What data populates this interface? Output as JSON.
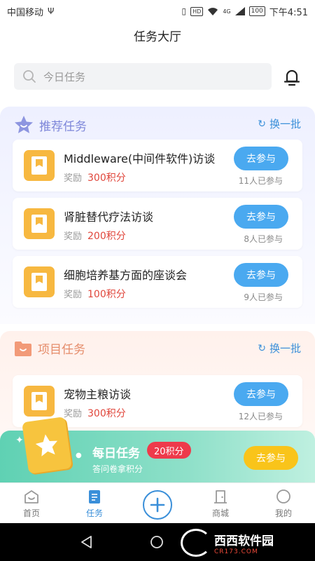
{
  "status_bar": {
    "carrier": "中国移动",
    "hd": "HD",
    "network": "4G",
    "battery": "100",
    "time": "下午4:51"
  },
  "header": {
    "title": "任务大厅"
  },
  "search": {
    "placeholder": "今日任务"
  },
  "recommended": {
    "title": "推荐任务",
    "refresh_label": "换一批",
    "tasks": [
      {
        "title": "Middleware(中间件软件)访谈",
        "reward_label": "奖励",
        "points": "300积分",
        "button": "去参与",
        "participants": "11人已参与"
      },
      {
        "title": "肾脏替代疗法访谈",
        "reward_label": "奖励",
        "points": "200积分",
        "button": "去参与",
        "participants": "8人已参与"
      },
      {
        "title": "细胞培养基方面的座谈会",
        "reward_label": "奖励",
        "points": "100积分",
        "button": "去参与",
        "participants": "9人已参与"
      }
    ]
  },
  "project": {
    "title": "项目任务",
    "refresh_label": "换一批",
    "tasks": [
      {
        "title": "宠物主粮访谈",
        "reward_label": "奖励",
        "points": "300积分",
        "button": "去参与",
        "participants": "12人已参与"
      }
    ]
  },
  "daily_banner": {
    "title": "每日任务",
    "badge": "20积分",
    "subtitle": "答问卷拿积分",
    "button": "去参与"
  },
  "tab_bar": {
    "items": [
      {
        "label": "首页",
        "active": false
      },
      {
        "label": "任务",
        "active": true
      },
      {
        "label": "",
        "active": false
      },
      {
        "label": "商城",
        "active": false
      },
      {
        "label": "我的",
        "active": false
      }
    ]
  },
  "watermark": {
    "brand": "西西软件园",
    "domain": "CR173.COM"
  },
  "colors": {
    "accent_blue": "#4aa9f0",
    "link_blue": "#3a8fd9",
    "points_red": "#e0463b",
    "task_icon": "#f7b840",
    "banner_green": "#5fd1b3",
    "banner_button": "#f9c41a"
  }
}
